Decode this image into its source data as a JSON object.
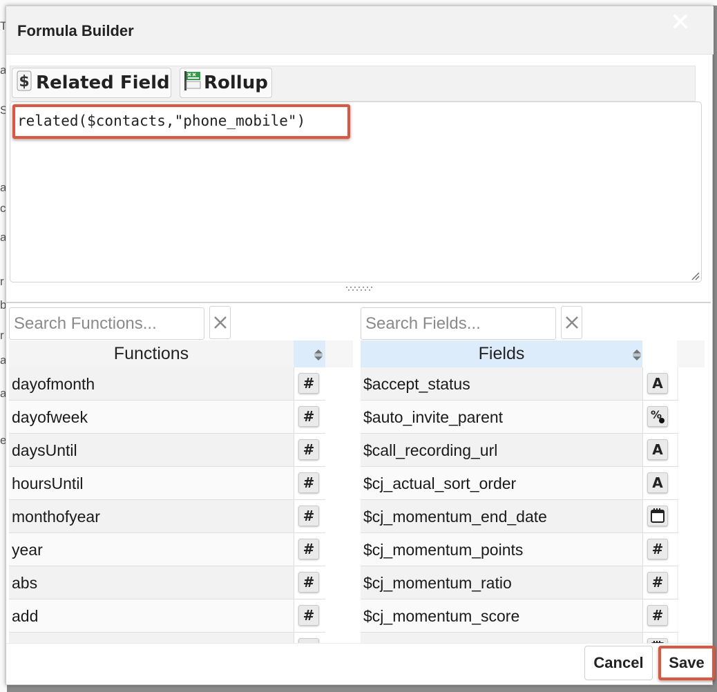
{
  "background": {
    "letters": [
      "T",
      "a",
      "S",
      "a",
      "c",
      "a",
      "r",
      "b",
      "r",
      "a",
      "a",
      "e"
    ]
  },
  "dialog": {
    "title": "Formula Builder",
    "close_icon": "close-x-icon"
  },
  "toolbar": {
    "related_field_label": "Related Field",
    "related_field_icon": "dollar-icon",
    "rollup_label": "Rollup",
    "rollup_icon": "rollup-flag-icon"
  },
  "editor": {
    "formula": "related($contacts,\"phone_mobile\")",
    "highlight_color": "#e4533a"
  },
  "functions_panel": {
    "search_placeholder": "Search Functions...",
    "header": "Functions",
    "items": [
      {
        "name": "dayofmonth",
        "type": "#"
      },
      {
        "name": "dayofweek",
        "type": "#"
      },
      {
        "name": "daysUntil",
        "type": "#"
      },
      {
        "name": "hoursUntil",
        "type": "#"
      },
      {
        "name": "monthofyear",
        "type": "#"
      },
      {
        "name": "year",
        "type": "#"
      },
      {
        "name": "abs",
        "type": "#"
      },
      {
        "name": "add",
        "type": "#"
      },
      {
        "name": "",
        "type": "#"
      }
    ]
  },
  "fields_panel": {
    "search_placeholder": "Search Fields...",
    "header": "Fields",
    "items": [
      {
        "name": "$accept_status",
        "type": "A"
      },
      {
        "name": "$auto_invite_parent",
        "type": "percent"
      },
      {
        "name": "$call_recording_url",
        "type": "A"
      },
      {
        "name": "$cj_actual_sort_order",
        "type": "A"
      },
      {
        "name": "$cj_momentum_end_date",
        "type": "calendar"
      },
      {
        "name": "$cj_momentum_points",
        "type": "#"
      },
      {
        "name": "$cj_momentum_ratio",
        "type": "#"
      },
      {
        "name": "$cj_momentum_score",
        "type": "#"
      },
      {
        "name": "",
        "type": "calendar"
      }
    ]
  },
  "footer": {
    "cancel_label": "Cancel",
    "save_label": "Save"
  }
}
